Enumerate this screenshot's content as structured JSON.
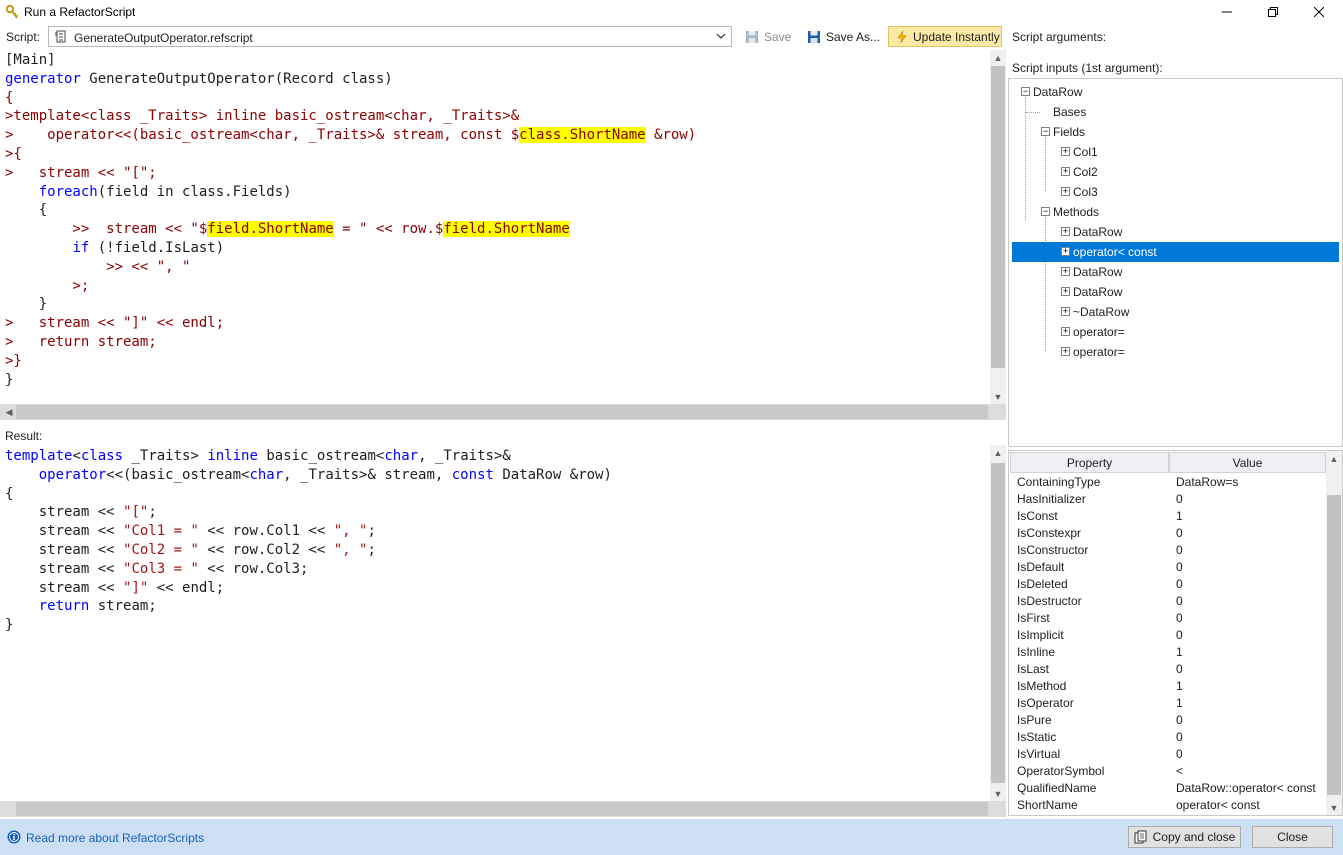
{
  "window": {
    "title": "Run a RefactorScript"
  },
  "toolbar": {
    "script_label": "Script:",
    "script_file": "GenerateOutputOperator.refscript",
    "save": "Save",
    "save_as": "Save As...",
    "update_instantly": "Update Instantly",
    "update_instantly_active": true
  },
  "right_panel": {
    "script_arguments_label": "Script arguments:",
    "script_inputs_label": "Script inputs (1st argument):"
  },
  "result_label": "Result:",
  "tree": {
    "root": "DataRow",
    "bases": "Bases",
    "fields": "Fields",
    "field_items": [
      "Col1",
      "Col2",
      "Col3"
    ],
    "methods": "Methods",
    "method_items": [
      "DataRow",
      "operator< const",
      "DataRow",
      "DataRow",
      "~DataRow",
      "operator=",
      "operator="
    ],
    "selected": "operator< const"
  },
  "property_grid": {
    "header_property": "Property",
    "header_value": "Value",
    "rows": [
      [
        "ContainingType",
        "DataRow=s"
      ],
      [
        "HasInitializer",
        "0"
      ],
      [
        "IsConst",
        "1"
      ],
      [
        "IsConstexpr",
        "0"
      ],
      [
        "IsConstructor",
        "0"
      ],
      [
        "IsDefault",
        "0"
      ],
      [
        "IsDeleted",
        "0"
      ],
      [
        "IsDestructor",
        "0"
      ],
      [
        "IsFirst",
        "0"
      ],
      [
        "IsImplicit",
        "0"
      ],
      [
        "IsInline",
        "1"
      ],
      [
        "IsLast",
        "0"
      ],
      [
        "IsMethod",
        "1"
      ],
      [
        "IsOperator",
        "1"
      ],
      [
        "IsPure",
        "0"
      ],
      [
        "IsStatic",
        "0"
      ],
      [
        "IsVirtual",
        "0"
      ],
      [
        "OperatorSymbol",
        "<"
      ],
      [
        "QualifiedName",
        "DataRow::operator< const"
      ],
      [
        "ShortName",
        "operator< const"
      ]
    ]
  },
  "script_code": [
    [
      [
        "[Main]",
        ""
      ]
    ],
    [
      [
        "generator",
        "kw"
      ],
      [
        " GenerateOutputOperator(Record class)",
        ""
      ]
    ],
    [
      [
        "{",
        "gen"
      ]
    ],
    [
      [
        ">template<class _Traits> inline basic_ostream<char, _Traits>&",
        "gen"
      ]
    ],
    [
      [
        ">    operator<<(basic_ostream<char, _Traits>& stream, const $",
        "gen"
      ],
      [
        "class.ShortName",
        "hl"
      ],
      [
        " &row)",
        "gen"
      ]
    ],
    [
      [
        ">{",
        "gen"
      ]
    ],
    [
      [
        ">   stream << \"[\";",
        "gen"
      ]
    ],
    [
      [
        "    ",
        ""
      ],
      [
        "foreach",
        "kw"
      ],
      [
        "(field in class.Fields)",
        ""
      ]
    ],
    [
      [
        "    {",
        ""
      ]
    ],
    [
      [
        "        >>  stream << \"$",
        "gen"
      ],
      [
        "field.ShortName",
        "hl"
      ],
      [
        " = \" << row.$",
        "gen"
      ],
      [
        "field.ShortName",
        "hl"
      ]
    ],
    [
      [
        "        ",
        ""
      ],
      [
        "if",
        "kw"
      ],
      [
        " (!field.IsLast)",
        ""
      ]
    ],
    [
      [
        "            >> << \", \"",
        "gen"
      ]
    ],
    [
      [
        "        >;",
        "gen"
      ]
    ],
    [
      [
        "    }",
        ""
      ]
    ],
    [
      [
        ">   stream << \"]\" << endl;",
        "gen"
      ]
    ],
    [
      [
        ">   return stream;",
        "gen"
      ]
    ],
    [
      [
        ">}",
        "gen"
      ]
    ],
    [
      [
        "}",
        ""
      ]
    ]
  ],
  "result_code": [
    [
      [
        "template",
        "kw"
      ],
      [
        "<",
        ""
      ],
      [
        "class",
        "kw"
      ],
      [
        " _Traits> ",
        ""
      ],
      [
        "inline",
        "kw"
      ],
      [
        " basic_ostream<",
        ""
      ],
      [
        "char",
        "kw"
      ],
      [
        ", _Traits>&",
        ""
      ]
    ],
    [
      [
        "    ",
        ""
      ],
      [
        "operator",
        "kw"
      ],
      [
        "<<(basic_ostream<",
        ""
      ],
      [
        "char",
        "kw"
      ],
      [
        ", _Traits>& stream, ",
        ""
      ],
      [
        "const",
        "kw"
      ],
      [
        " DataRow &row)",
        ""
      ]
    ],
    [
      [
        "{",
        ""
      ]
    ],
    [
      [
        "    stream << ",
        ""
      ],
      [
        "\"[\"",
        "st"
      ],
      [
        ";",
        ""
      ]
    ],
    [
      [
        "    stream << ",
        ""
      ],
      [
        "\"Col1 = \"",
        "st"
      ],
      [
        " << row.Col1 << ",
        ""
      ],
      [
        "\", \"",
        "st"
      ],
      [
        ";",
        ""
      ]
    ],
    [
      [
        "    stream << ",
        ""
      ],
      [
        "\"Col2 = \"",
        "st"
      ],
      [
        " << row.Col2 << ",
        ""
      ],
      [
        "\", \"",
        "st"
      ],
      [
        ";",
        ""
      ]
    ],
    [
      [
        "    stream << ",
        ""
      ],
      [
        "\"Col3 = \"",
        "st"
      ],
      [
        " << row.Col3;",
        ""
      ]
    ],
    [
      [
        "    stream << ",
        ""
      ],
      [
        "\"]\"",
        "st"
      ],
      [
        " << endl;",
        ""
      ]
    ],
    [
      [
        "    ",
        ""
      ],
      [
        "return",
        "kw"
      ],
      [
        " stream;",
        ""
      ]
    ],
    [
      [
        "}",
        ""
      ]
    ]
  ],
  "footer": {
    "help_link": "Read more about RefactorScripts",
    "copy_and_close": "Copy and close",
    "close": "Close"
  }
}
